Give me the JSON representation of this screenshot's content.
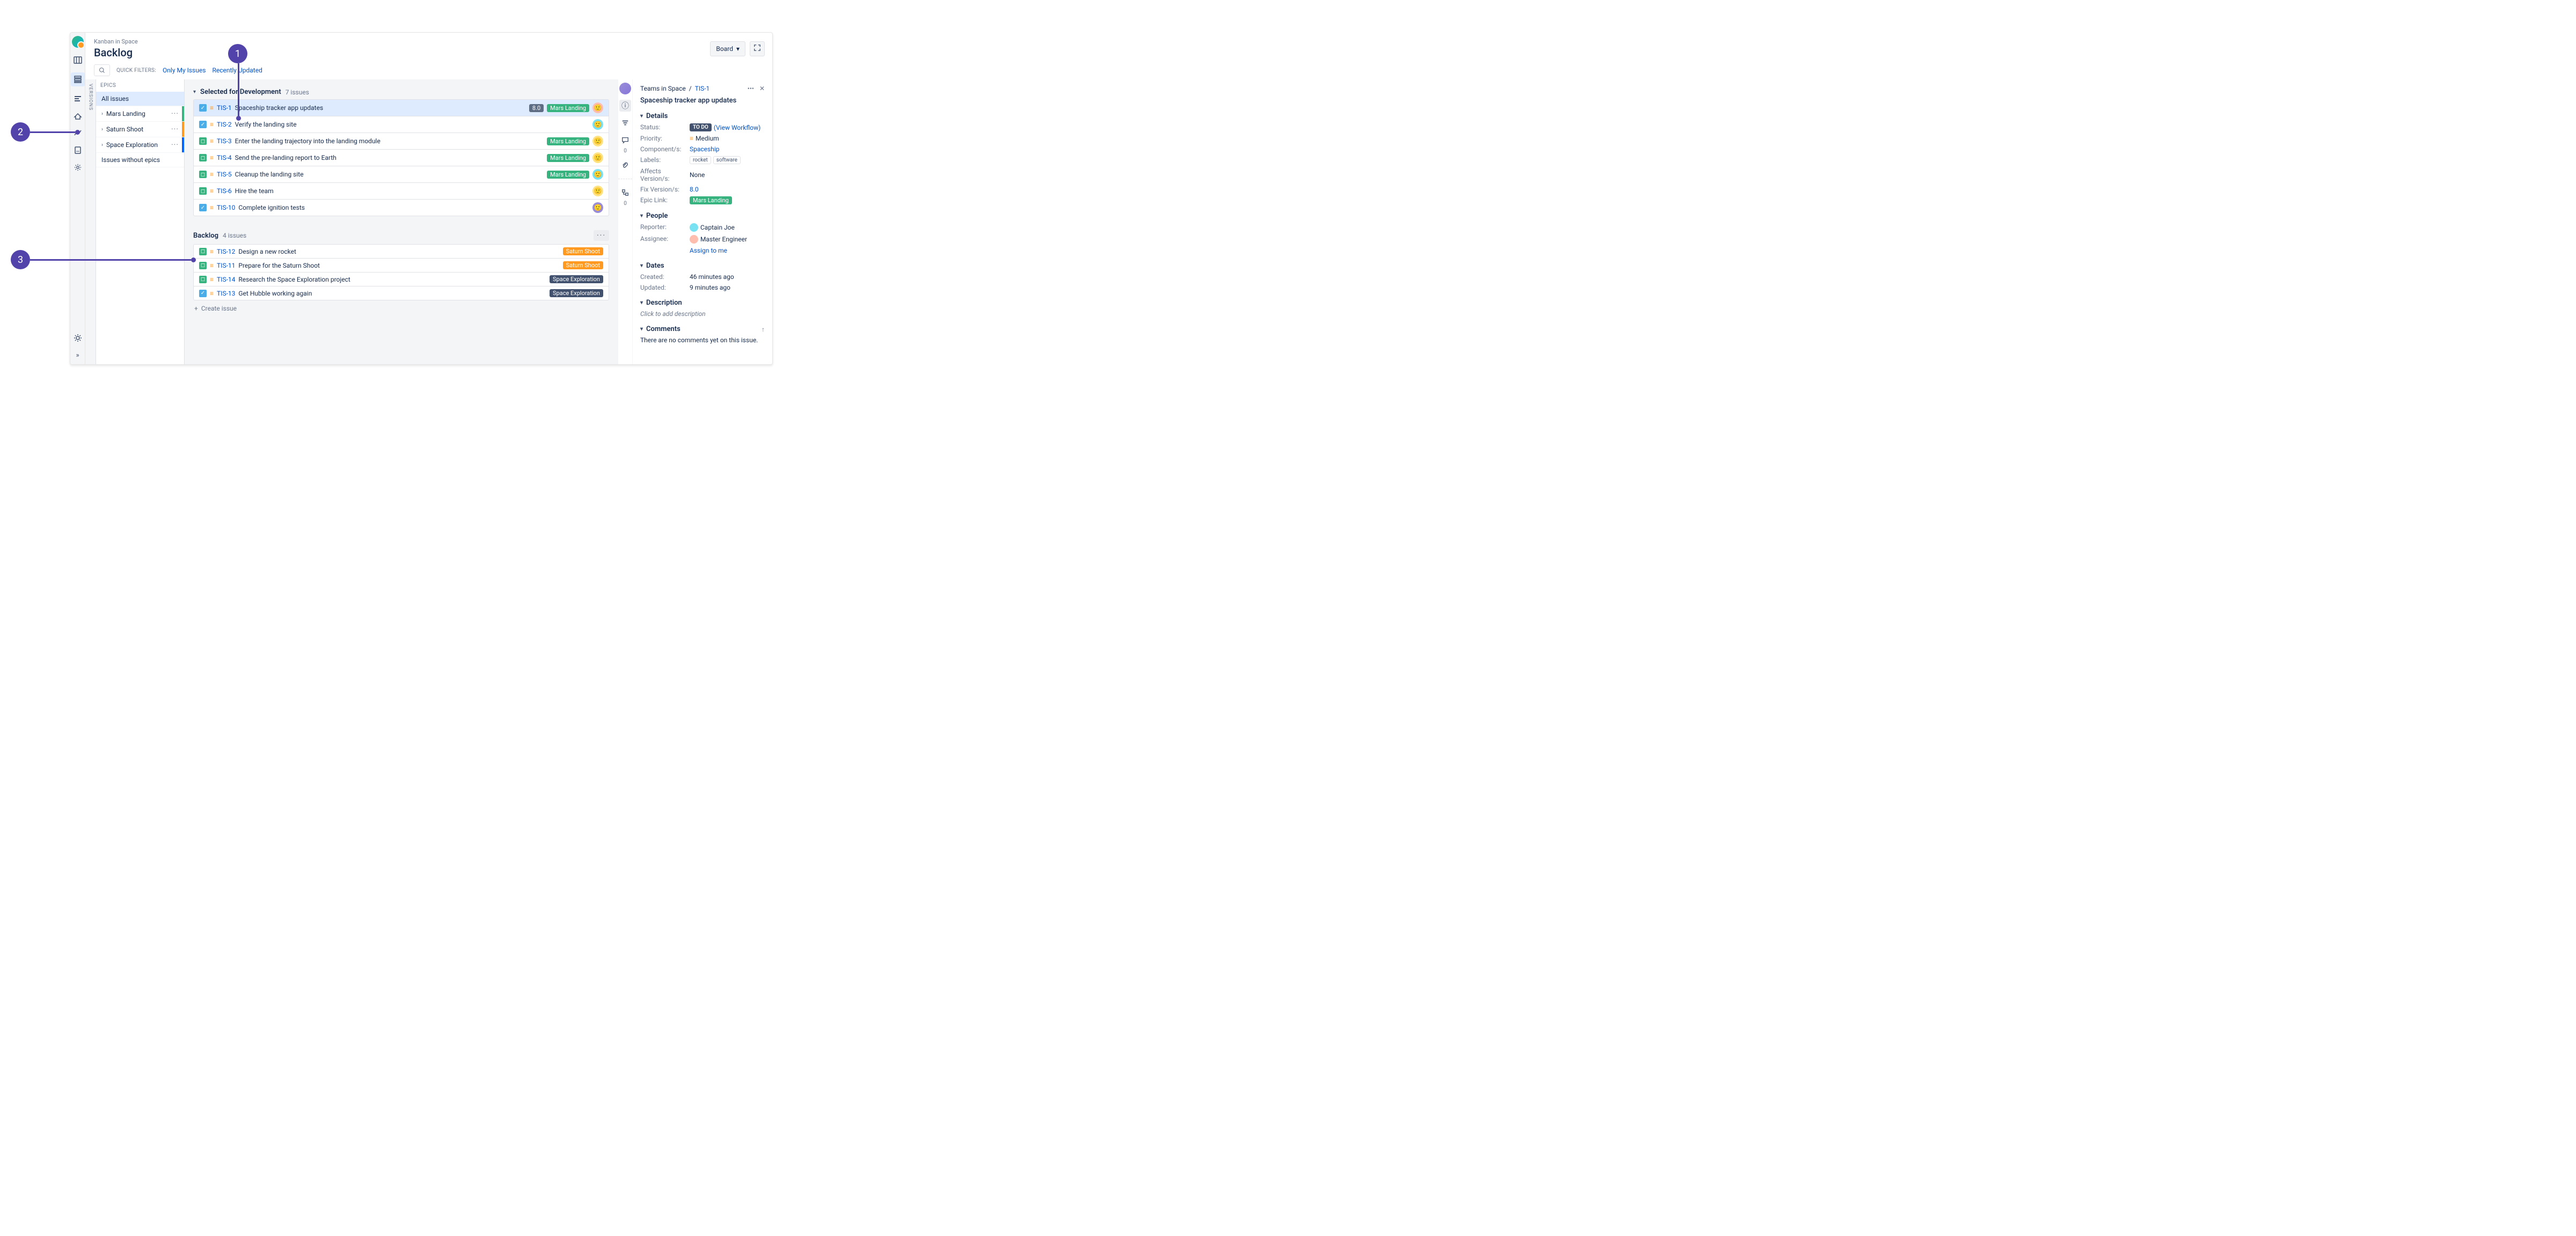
{
  "annotations": [
    "1",
    "2",
    "3"
  ],
  "project_name": "Kanban in Space",
  "page_title": "Backlog",
  "quick_filters_label": "QUICK FILTERS:",
  "filters": [
    "Only My Issues",
    "Recently Updated"
  ],
  "board_button": "Board",
  "versions_label": "VERSIONS",
  "epics_header": "EPICS",
  "epics": {
    "all": "All issues",
    "items": [
      {
        "name": "Mars Landing",
        "stripe": "green"
      },
      {
        "name": "Saturn Shoot",
        "stripe": "orange"
      },
      {
        "name": "Space Exploration",
        "stripe": "blue"
      }
    ],
    "without": "Issues without epics"
  },
  "sections": {
    "dev": {
      "title": "Selected for Development",
      "count": "7 issues"
    },
    "backlog": {
      "title": "Backlog",
      "count": "4 issues"
    }
  },
  "dev_issues": [
    {
      "type": "task",
      "key": "TIS-1",
      "summary": "Spaceship tracker app updates",
      "version": "8.0",
      "epic": "Mars Landing",
      "epic_cls": "eb-green",
      "av": "av-red",
      "selected": true
    },
    {
      "type": "task",
      "key": "TIS-2",
      "summary": "Verify the landing site",
      "av": "av-teal"
    },
    {
      "type": "story",
      "key": "TIS-3",
      "summary": "Enter the landing trajectory into the landing module",
      "epic": "Mars Landing",
      "epic_cls": "eb-green",
      "av": "av-yellow"
    },
    {
      "type": "story",
      "key": "TIS-4",
      "summary": "Send the pre-landing report to Earth",
      "epic": "Mars Landing",
      "epic_cls": "eb-green",
      "av": "av-yellow"
    },
    {
      "type": "story",
      "key": "TIS-5",
      "summary": "Cleanup the landing site",
      "epic": "Mars Landing",
      "epic_cls": "eb-green",
      "av": "av-teal"
    },
    {
      "type": "story",
      "key": "TIS-6",
      "summary": "Hire the team",
      "av": "av-yellow"
    },
    {
      "type": "task",
      "key": "TIS-10",
      "summary": "Complete ignition tests",
      "av": "av-purple"
    }
  ],
  "backlog_issues": [
    {
      "type": "story",
      "key": "TIS-12",
      "summary": "Design a new rocket",
      "epic": "Saturn Shoot",
      "epic_cls": "eb-orange"
    },
    {
      "type": "story",
      "key": "TIS-11",
      "summary": "Prepare for the Saturn Shoot",
      "epic": "Saturn Shoot",
      "epic_cls": "eb-orange"
    },
    {
      "type": "story",
      "key": "TIS-14",
      "summary": "Research the Space Exploration project",
      "epic": "Space Exploration",
      "epic_cls": "eb-navy"
    },
    {
      "type": "task",
      "key": "TIS-13",
      "summary": "Get Hubble working again",
      "epic": "Space Exploration",
      "epic_cls": "eb-navy"
    }
  ],
  "create_issue": "Create issue",
  "detail": {
    "breadcrumb_project": "Teams in Space",
    "breadcrumb_key": "TIS-1",
    "title": "Spaceship tracker app updates",
    "sections": {
      "details": "Details",
      "people": "People",
      "dates": "Dates",
      "description": "Description",
      "comments": "Comments"
    },
    "fields": {
      "status_label": "Status:",
      "status": "TO DO",
      "workflow": "(View Workflow)",
      "priority_label": "Priority:",
      "priority": "Medium",
      "components_label": "Component/s:",
      "components": "Spaceship",
      "labels_label": "Labels:",
      "labels": [
        "rocket",
        "software"
      ],
      "affects_label": "Affects Version/s:",
      "affects": "None",
      "fix_label": "Fix Version/s:",
      "fix": "8.0",
      "epic_label": "Epic Link:",
      "epic": "Mars Landing"
    },
    "people": {
      "reporter_label": "Reporter:",
      "reporter": "Captain Joe",
      "assignee_label": "Assignee:",
      "assignee": "Master Engineer",
      "assign_to_me": "Assign to me"
    },
    "dates": {
      "created_label": "Created:",
      "created": "46 minutes ago",
      "updated_label": "Updated:",
      "updated": "9 minutes ago"
    },
    "description_placeholder": "Click to add description",
    "comments_empty": "There are no comments yet on this issue."
  },
  "detail_rail_counts": {
    "comments": "0",
    "subtasks": "0"
  }
}
